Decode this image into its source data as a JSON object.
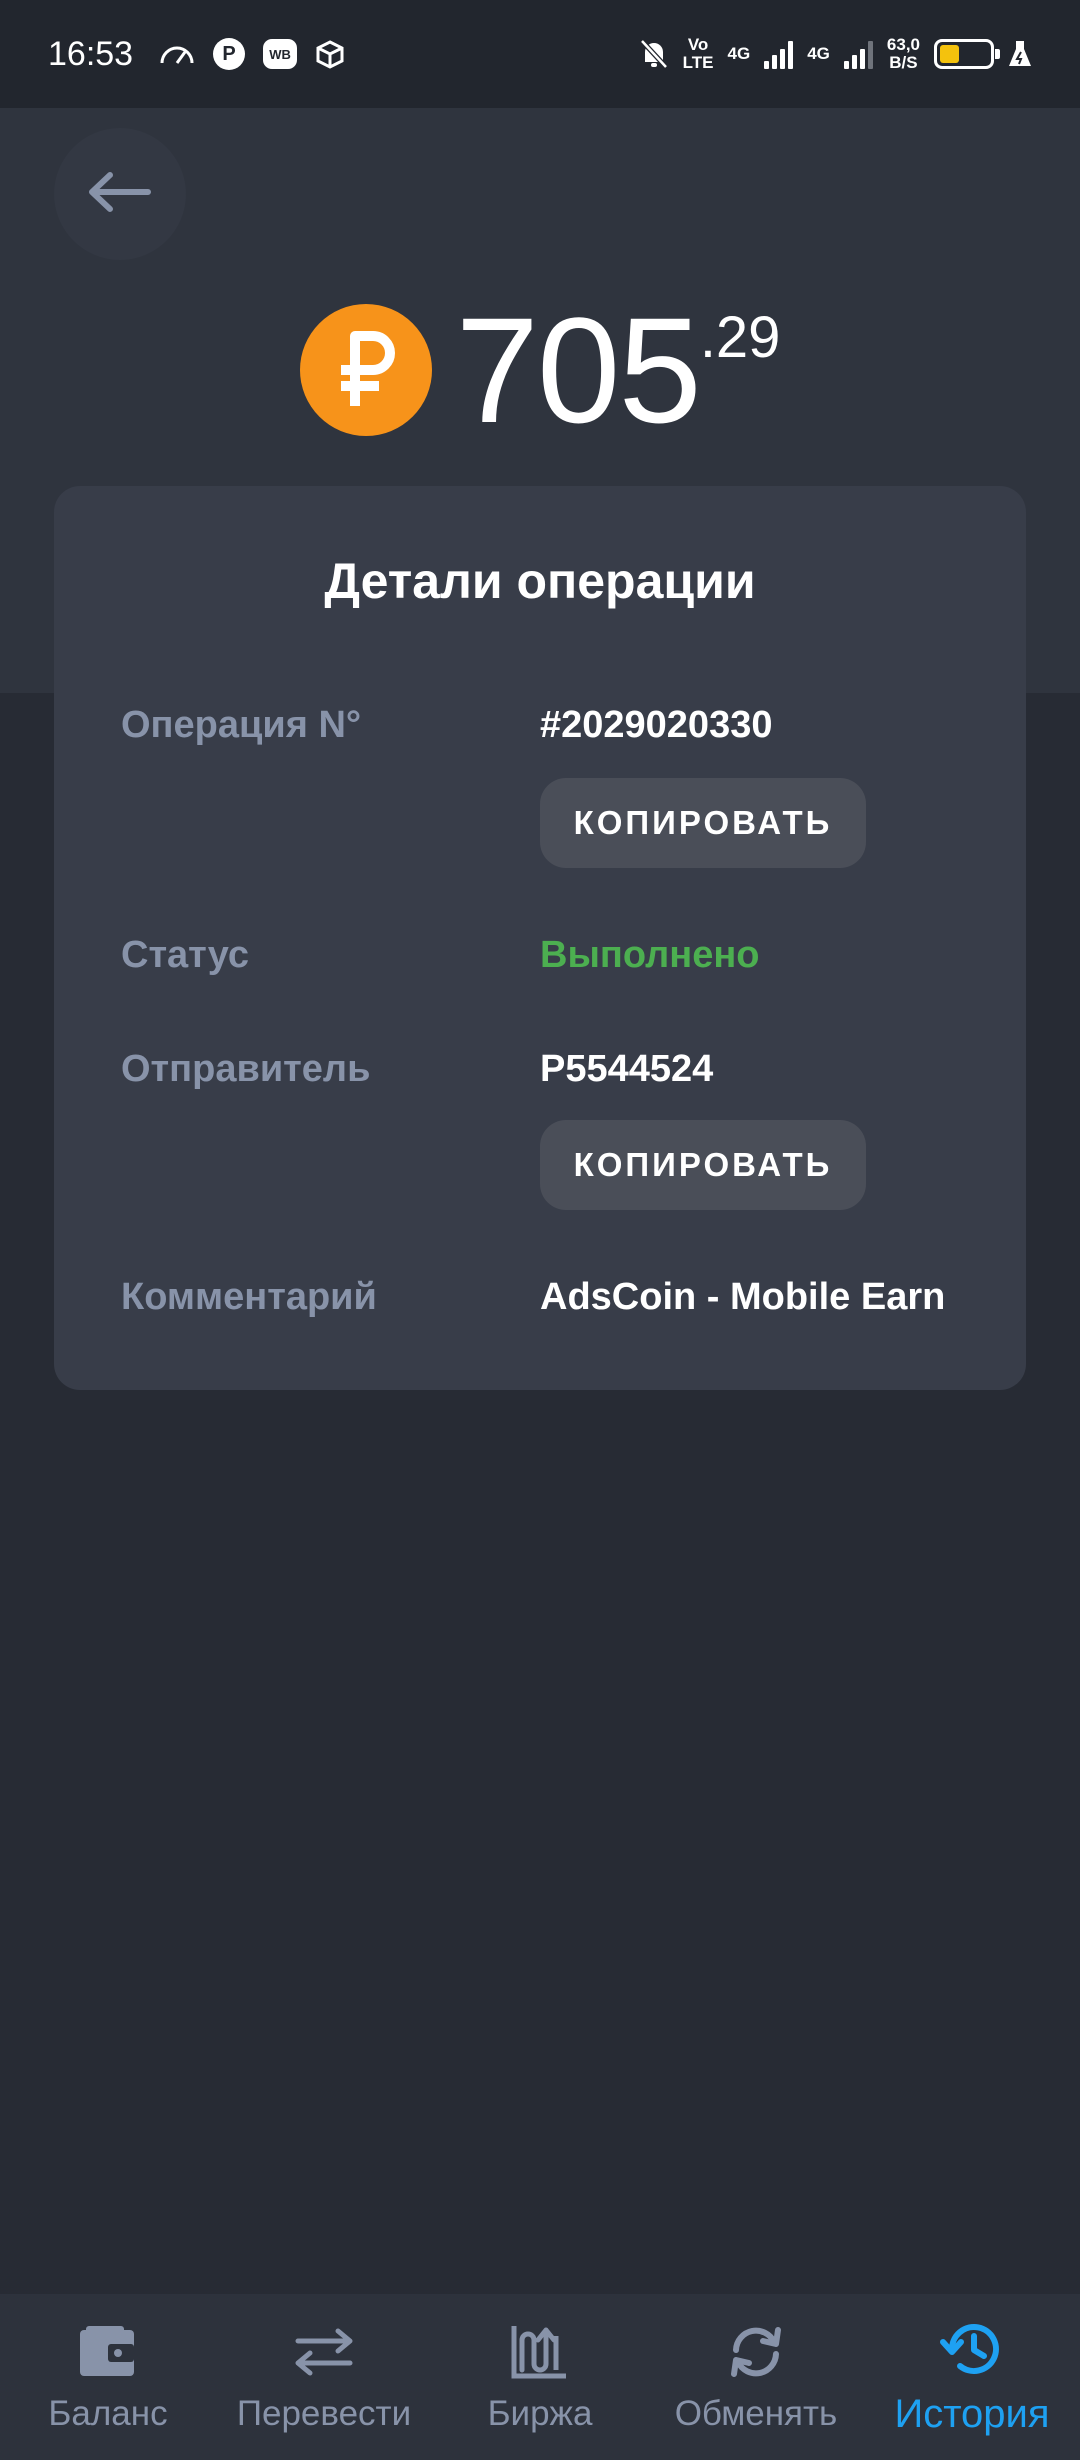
{
  "status_bar": {
    "time": "16:53",
    "p_badge": "P",
    "wb_badge": "WB",
    "volte_top": "Vo",
    "volte_bottom": "LTE",
    "net1": "4G",
    "net2": "4G",
    "speed_value": "63,0",
    "speed_unit": "B/S",
    "battery_level": 0.4,
    "icons": [
      "speedometer-icon",
      "box-icon",
      "bell-off-icon",
      "signal-icon",
      "battery-icon",
      "flask-icon"
    ]
  },
  "header": {
    "back_icon": "arrow-left-icon",
    "currency_icon": "ruble-coin-icon",
    "amount_main": "705",
    "amount_fraction": ".29"
  },
  "card": {
    "title": "Детали операции",
    "rows": [
      {
        "label": "Операция N°",
        "value": "#2029020330",
        "copy": "КОПИРОВАТЬ"
      },
      {
        "label": "Статус",
        "value": "Выполнено"
      },
      {
        "label": "Отправитель",
        "value": "P5544524",
        "copy": "КОПИРОВАТЬ"
      },
      {
        "label": "Комментарий",
        "value": "AdsCoin - Mobile Earn"
      }
    ]
  },
  "nav": {
    "items": [
      {
        "label": "Баланс",
        "icon": "wallet-icon"
      },
      {
        "label": "Перевести",
        "icon": "transfer-arrows-icon"
      },
      {
        "label": "Биржа",
        "icon": "exchange-chart-icon"
      },
      {
        "label": "Обменять",
        "icon": "refresh-icon"
      },
      {
        "label": "История",
        "icon": "history-icon",
        "active": true
      }
    ]
  },
  "colors": {
    "background": "#272b34",
    "card": "#383d49",
    "accent": "#1ea1f2",
    "success": "#4caf50",
    "coin": "#f7931a",
    "label": "#8893a9"
  }
}
